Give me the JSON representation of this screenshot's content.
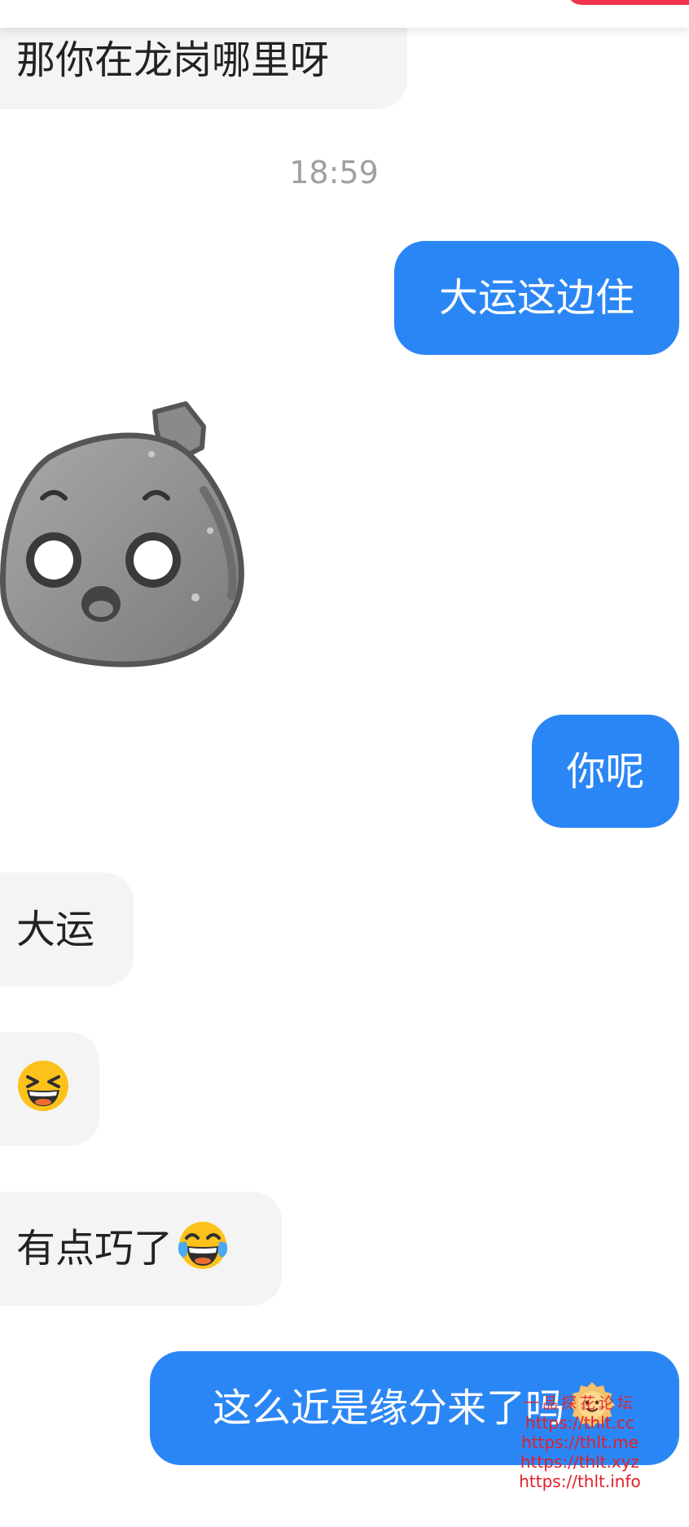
{
  "chat": {
    "messages": [
      {
        "side": "in",
        "text": "那你在龙岗哪里呀"
      },
      {
        "type": "timestamp",
        "text": "18:59"
      },
      {
        "side": "out",
        "text": "大运这边住"
      },
      {
        "side": "in",
        "type": "sticker",
        "icon": "surprised-potato-sticker"
      },
      {
        "side": "out",
        "text": "你呢"
      },
      {
        "side": "in",
        "text": "大运"
      },
      {
        "side": "in",
        "type": "emoji",
        "icon": "grinning-squinting-face-emoji"
      },
      {
        "side": "in",
        "text": "有点巧了",
        "trailing_icon": "tears-of-joy-emoji"
      },
      {
        "side": "out",
        "text": "这么近是缘分来了吗",
        "trailing_icon": "smiling-face-emoji"
      }
    ]
  },
  "watermark": {
    "title": "一品探花论坛",
    "urls": [
      "https://thlt.cc",
      "https://thlt.me",
      "https://thlt.xyz",
      "https://thlt.info"
    ]
  },
  "colors": {
    "outgoing_bubble": "#2b86f5",
    "incoming_bubble": "#f4f4f4",
    "accent": "#f0344c",
    "watermark": "#e21f28"
  }
}
